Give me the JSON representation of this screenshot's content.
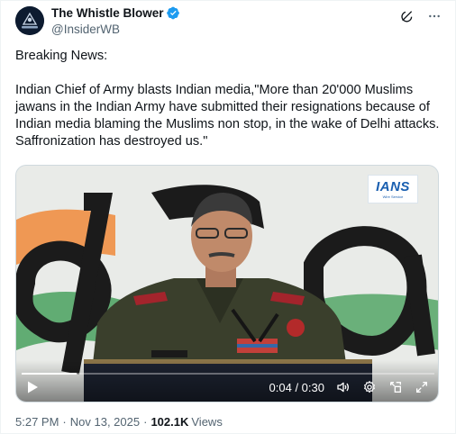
{
  "author": {
    "name": "The Whistle Blower",
    "handle": "@InsiderWB",
    "avatar_caption": "",
    "verified_color": "#1d9bf0"
  },
  "post": {
    "paragraphs": [
      "Breaking News:",
      "Indian Chief of Army blasts Indian media,\"More than 20'000 Muslims jawans in the Indian Army have submitted their resignations because of Indian media blaming the Muslims non stop, in the wake of Delhi attacks. Saffronization has destroyed us.\""
    ]
  },
  "video": {
    "watermark": "IANS",
    "watermark_sub": "Wire Service",
    "time_display": "0:04 / 0:30",
    "progress_fraction": 0.133
  },
  "meta": {
    "time": "5:27 PM",
    "date": "Nov 13, 2025",
    "separator": "·",
    "views_count": "102.1K",
    "views_label": "Views"
  },
  "colors": {
    "text": "#0f1419",
    "secondary": "#536471",
    "accent": "#1d9bf0"
  },
  "icons": {
    "grok": "grok-icon",
    "more": "more-icon",
    "play": "play-icon",
    "volume": "volume-icon",
    "settings": "settings-icon",
    "pip": "pip-icon",
    "fullscreen": "fullscreen-icon"
  }
}
